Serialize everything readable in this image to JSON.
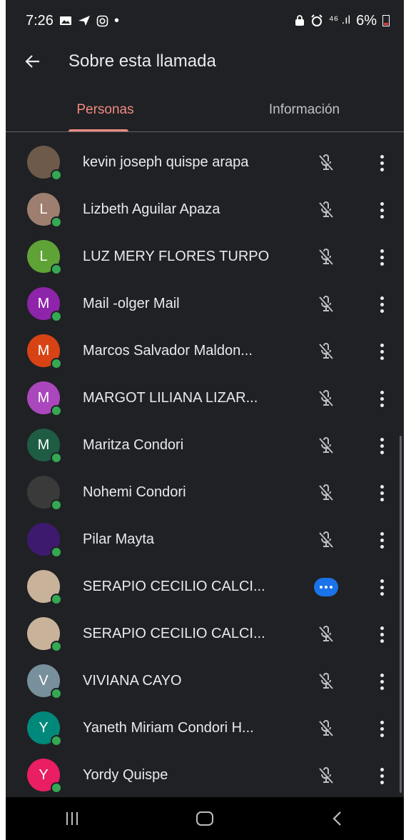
{
  "status_bar": {
    "time": "7:26",
    "dot": "•",
    "signal": "⁴⁶ .ıl",
    "battery": "6%",
    "left_icons": [
      "image-icon",
      "send-icon",
      "instagram-icon"
    ],
    "right_icons": [
      "lock-icon",
      "alarm-icon",
      "signal-icon",
      "battery-icon"
    ]
  },
  "header": {
    "title": "Sobre esta llamada"
  },
  "tabs": [
    {
      "label": "Personas",
      "active": true
    },
    {
      "label": "Información",
      "active": false
    }
  ],
  "participants": [
    {
      "name": "kevin joseph quispe arapa",
      "initial": "",
      "avatar_color": "#6d5a4a",
      "mic": "muted"
    },
    {
      "name": "Lizbeth Aguilar Apaza",
      "initial": "L",
      "avatar_color": "#9e7e6e",
      "mic": "muted"
    },
    {
      "name": "LUZ MERY FLORES TURPO",
      "initial": "L",
      "avatar_color": "#5fa337",
      "mic": "muted"
    },
    {
      "name": "Mail -olger Mail",
      "initial": "M",
      "avatar_color": "#8e24aa",
      "mic": "muted"
    },
    {
      "name": "Marcos Salvador Maldon...",
      "initial": "M",
      "avatar_color": "#d84315",
      "mic": "muted"
    },
    {
      "name": "MARGOT LILIANA LIZAR...",
      "initial": "M",
      "avatar_color": "#ab47bc",
      "mic": "muted"
    },
    {
      "name": "Maritza Condori",
      "initial": "M",
      "avatar_color": "#1e5c43",
      "mic": "muted"
    },
    {
      "name": "Nohemi Condori",
      "initial": "",
      "avatar_color": "#3a3a3a",
      "mic": "muted"
    },
    {
      "name": "Pilar Mayta",
      "initial": "",
      "avatar_color": "#3d1a6e",
      "mic": "muted"
    },
    {
      "name": "SERAPIO CECILIO CALCI...",
      "initial": "",
      "avatar_color": "#c9b29a",
      "mic": "speaking"
    },
    {
      "name": "SERAPIO CECILIO CALCI...",
      "initial": "",
      "avatar_color": "#c9b29a",
      "mic": "muted"
    },
    {
      "name": "VIVIANA CAYO",
      "initial": "V",
      "avatar_color": "#78909c",
      "mic": "muted"
    },
    {
      "name": "Yaneth Miriam Condori H...",
      "initial": "Y",
      "avatar_color": "#00897b",
      "mic": "muted"
    },
    {
      "name": "Yordy Quispe",
      "initial": "Y",
      "avatar_color": "#e91e63",
      "mic": "muted"
    }
  ],
  "colors": {
    "background": "#202124",
    "accent": "#f28b82",
    "online": "#34a853",
    "speaking": "#1a73e8"
  },
  "nav_bar": {
    "icons": [
      "recents-icon",
      "home-icon",
      "back-icon"
    ]
  }
}
